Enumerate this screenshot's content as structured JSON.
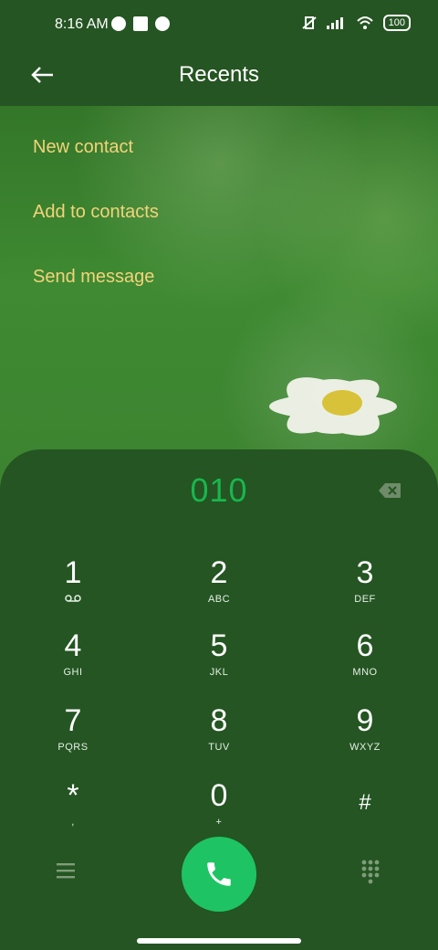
{
  "status": {
    "time": "8:16 AM",
    "battery": "100"
  },
  "header": {
    "title": "Recents"
  },
  "options": [
    "New contact",
    "Add to contacts",
    "Send message"
  ],
  "dialer": {
    "number": "010",
    "keys": [
      {
        "digit": "1",
        "letters": "ᴏᴏ"
      },
      {
        "digit": "2",
        "letters": "ABC"
      },
      {
        "digit": "3",
        "letters": "DEF"
      },
      {
        "digit": "4",
        "letters": "GHI"
      },
      {
        "digit": "5",
        "letters": "JKL"
      },
      {
        "digit": "6",
        "letters": "MNO"
      },
      {
        "digit": "7",
        "letters": "PQRS"
      },
      {
        "digit": "8",
        "letters": "TUV"
      },
      {
        "digit": "9",
        "letters": "WXYZ"
      },
      {
        "digit": "*",
        "letters": ","
      },
      {
        "digit": "0",
        "letters": "+"
      },
      {
        "digit": "#",
        "letters": ""
      }
    ]
  },
  "colors": {
    "accent_number": "#19b64d",
    "call_button": "#1ec463",
    "option_text": "#f3d37a"
  },
  "icons": [
    "back-arrow-icon",
    "backspace-icon",
    "menu-icon",
    "call-icon",
    "dialpad-grid-icon",
    "voicemail-icon"
  ]
}
